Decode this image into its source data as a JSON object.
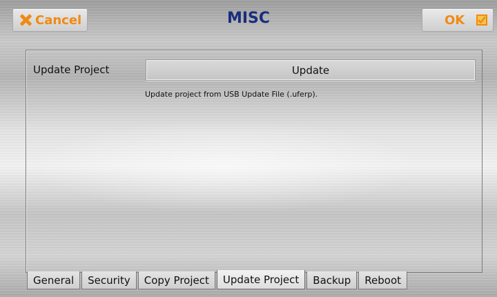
{
  "header": {
    "cancel_label": "Cancel",
    "title": "MISC",
    "ok_label": "OK",
    "accent_color": "#f08a12",
    "title_color": "#1a2d7d"
  },
  "main": {
    "row_label": "Update Project",
    "update_button_label": "Update",
    "description": "Update project from USB Update File (.uferp)."
  },
  "tabs": [
    {
      "label": "General"
    },
    {
      "label": "Security"
    },
    {
      "label": "Copy Project"
    },
    {
      "label": "Update Project",
      "active": true
    },
    {
      "label": "Backup"
    },
    {
      "label": "Reboot"
    }
  ]
}
